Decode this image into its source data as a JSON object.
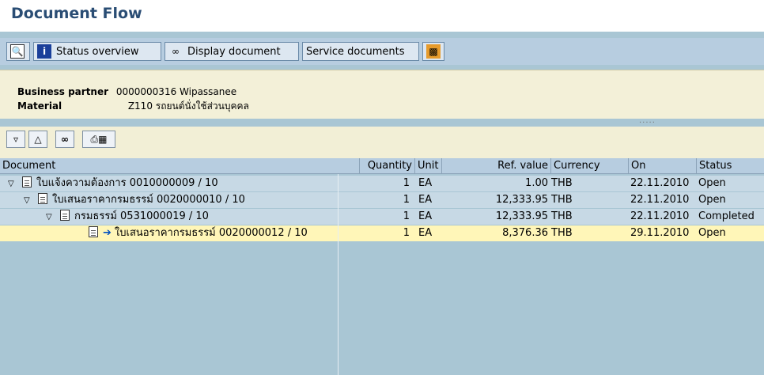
{
  "title": "Document Flow",
  "toolbar": {
    "status_overview": "Status overview",
    "display_document": "Display document",
    "service_documents": "Service documents"
  },
  "header": {
    "bp_label": "Business partner",
    "bp_value": "0000000316 Wipassanee",
    "mat_label": "Material",
    "mat_value": "Z110 รถยนต์นั่งใช้ส่วนบุคคล"
  },
  "grid": {
    "columns": [
      "Document",
      "Quantity",
      "Unit",
      "Ref. value",
      "Currency",
      "On",
      "Status"
    ],
    "rows": [
      {
        "doc": "ใบแจ้งความต้องการ 0010000009 / 10",
        "qty": "1",
        "unit": "EA",
        "ref": "1.00",
        "cur": "THB",
        "on": "22.11.2010",
        "status": "Open"
      },
      {
        "doc": "ใบเสนอราคากรมธรรม์ 0020000010 / 10",
        "qty": "1",
        "unit": "EA",
        "ref": "12,333.95",
        "cur": "THB",
        "on": "22.11.2010",
        "status": "Open"
      },
      {
        "doc": "กรมธรรม์ 0531000019 / 10",
        "qty": "1",
        "unit": "EA",
        "ref": "12,333.95",
        "cur": "THB",
        "on": "22.11.2010",
        "status": "Completed"
      },
      {
        "doc": "ใบเสนอราคากรมธรรม์ 0020000012 / 10",
        "qty": "1",
        "unit": "EA",
        "ref": "8,376.36",
        "cur": "THB",
        "on": "29.11.2010",
        "status": "Open"
      }
    ]
  }
}
